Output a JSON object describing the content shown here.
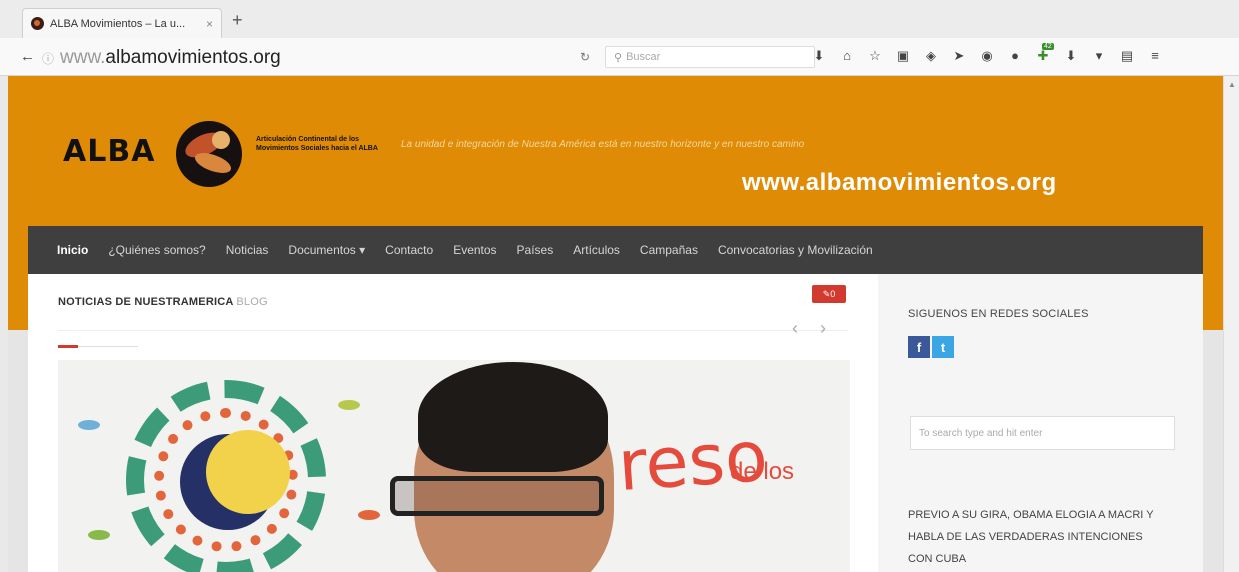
{
  "browser": {
    "tab_title": "ALBA Movimientos – La u...",
    "tab_close": "×",
    "new_tab": "+",
    "back": "←",
    "url_info": "ⓘ",
    "url_prefix": "www.",
    "url_domain": "albamovimientos.org",
    "reload": "↻",
    "search_placeholder": "Buscar",
    "toolbar_icons": [
      "download-icon",
      "home-icon",
      "star-icon",
      "clipboard-icon",
      "pocket-icon",
      "send-icon",
      "ghostery-icon",
      "chat-icon",
      "addon-icon",
      "download2-icon",
      "menu-dropdown-icon",
      "reader-icon",
      "hamburger-icon"
    ],
    "addon_badge": "42"
  },
  "header": {
    "logo_text": "ALBA",
    "logo_subtitle": "Articulación Continental de los Movimientos Sociales hacia el ALBA",
    "tagline": "La unidad e integración de Nuestra América está en nuestro horizonte y en nuestro camino",
    "overlay_url": "www.albamovimientos.org",
    "brand_color": "#e08b06"
  },
  "menu": {
    "items": [
      "Inicio",
      "¿Quiénes somos?",
      "Noticias",
      "Documentos ▾",
      "Contacto",
      "Eventos",
      "Países",
      "Artículos",
      "Campañas",
      "Convocatorias y Movilización"
    ]
  },
  "content": {
    "section_title": "NOTICIAS DE NUESTRAMERICA",
    "section_title_suffix": "BLOG",
    "prev": "‹",
    "next": "›",
    "comment_count": "0",
    "banner_text": "reso",
    "banner_small": "de los"
  },
  "sidebar": {
    "follow_title": "SIGUENOS EN REDES SOCIALES",
    "facebook": "f",
    "twitter": "t",
    "search_placeholder": "To search type and hit enter",
    "post_title": "PREVIO A SU GIRA, OBAMA ELOGIA A MACRI Y HABLA DE LAS VERDADERAS INTENCIONES CON CUBA"
  }
}
